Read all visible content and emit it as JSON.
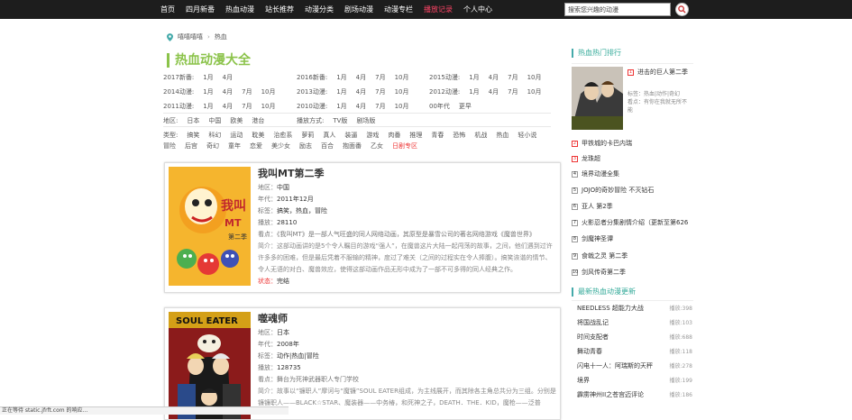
{
  "nav": {
    "items": [
      "首页",
      "四月新番",
      "热血动漫",
      "站长推荐",
      "动漫分类",
      "剧场动漫",
      "动漫专栏",
      "播放记录",
      "个人中心"
    ],
    "active_index": 7
  },
  "search": {
    "value": "搜索您兴趣的动漫"
  },
  "breadcrumb": {
    "home": "嘻嘻嘻嘻",
    "sep": "›",
    "current": "热血"
  },
  "page_title": "热血动漫大全",
  "filters": {
    "years": [
      {
        "label": "2017新番:",
        "items": [
          "1月",
          "4月"
        ]
      },
      {
        "label": "2016新番:",
        "items": [
          "1月",
          "4月",
          "7月",
          "10月"
        ]
      },
      {
        "label": "2015动漫:",
        "items": [
          "1月",
          "4月",
          "7月",
          "10月"
        ]
      },
      {
        "label": "2014动漫:",
        "items": [
          "1月",
          "4月",
          "7月",
          "10月"
        ]
      },
      {
        "label": "2013动漫:",
        "items": [
          "1月",
          "4月",
          "7月",
          "10月"
        ]
      },
      {
        "label": "2012动漫:",
        "items": [
          "1月",
          "4月",
          "7月",
          "10月"
        ]
      },
      {
        "label": "2011动漫:",
        "items": [
          "1月",
          "4月",
          "7月",
          "10月"
        ]
      },
      {
        "label": "2010动漫:",
        "items": [
          "1月",
          "4月",
          "7月",
          "10月"
        ]
      },
      {
        "label": "00年代",
        "items": [
          "更早"
        ]
      }
    ],
    "region": {
      "label": "地区:",
      "items": [
        "日本",
        "中国",
        "欧美",
        "港台"
      ]
    },
    "format": {
      "label": "播放方式:",
      "items": [
        "TV版",
        "剧场版"
      ]
    },
    "type": {
      "label": "类型:",
      "row1": [
        "搞笑",
        "科幻",
        "运动",
        "耽美",
        "治愈系",
        "萝莉",
        "真人",
        "装逼",
        "游戏",
        "肉番",
        "推理",
        "青春",
        "恐怖",
        "机战",
        "热血",
        "轻小说"
      ],
      "row2": [
        "冒险",
        "后宫",
        "奇幻",
        "童年",
        "恋爱",
        "美少女",
        "励志",
        "百合",
        "抱面番",
        "乙女",
        "日剧专区"
      ]
    }
  },
  "cards": [
    {
      "title": "我叫MT第二季",
      "region": "中国",
      "year": "2011年12月",
      "tags": "搞笑，热血，冒险",
      "plays": "28110",
      "intro": "《我叫MT》是一部人气旺盛的同人网络动画，其原型是暴雪公司的著名网络游戏《魔兽世界》",
      "desc": "这部动画讲的是5个令人瞩目的游戏“强人”，在魔兽这片大陆一起闯荡的故事，之间，他们遇到过许许多多的困难，但是最后凭着不服输的精神，度过了难关（之间的过程实在令人捧腹）。搞笑诙谐的情节、令人无语的对白、魔兽效应，使得这部动画作品无形中成为了一部不可多得的同人经典之作。",
      "status": "完结",
      "labels": {
        "region": "地区：",
        "year": "年代：",
        "tags": "标签：",
        "plays": "播放：",
        "intro": "看点：",
        "desc": "简介：",
        "status": "状态："
      }
    },
    {
      "title": "噬魂师",
      "region": "日本",
      "year": "2008年",
      "tags": "动作|热血|冒险",
      "plays": "128735",
      "intro": "舞台为死神武器职人专门学校",
      "desc": "故事以“镰职人”摩诃与“魔镰”SOUL EATER组成，为主线展开，而其除各主角总共分为三组。分别是镰镰职人——BLACK☆STAR、魔装器——中务椿，和死神之子，DEATH．THE．KID，魔枪——泛普",
      "status": "",
      "labels": {
        "region": "地区：",
        "year": "年代：",
        "tags": "标签：",
        "plays": "播放：",
        "intro": "看点：",
        "desc": "简介：",
        "status": "状态："
      }
    }
  ],
  "sidebar": {
    "rank_title": "热血热门排行",
    "top": {
      "num": "1",
      "name": "进击的巨人第二季",
      "tags_label": "标签：",
      "tags": "热血|动作|奇幻",
      "intro_label": "看点：",
      "intro": "有你在我就无所不能"
    },
    "rank": [
      {
        "num": "2",
        "name": "甲铁城的卡巴内瑞",
        "hot": true
      },
      {
        "num": "3",
        "name": "龙珠超",
        "hot": true
      },
      {
        "num": "4",
        "name": "境界动漫全集",
        "hot": false
      },
      {
        "num": "5",
        "name": "JOJO的奇妙冒险 不灭钻石",
        "hot": false
      },
      {
        "num": "6",
        "name": "亚人 第2季",
        "hot": false
      },
      {
        "num": "7",
        "name": "火影忍者分集剧情介绍（更新至第626",
        "hot": false
      },
      {
        "num": "8",
        "name": "剑魔神圣谭",
        "hot": false
      },
      {
        "num": "9",
        "name": "食戟之灵 第二季",
        "hot": false
      },
      {
        "num": "10",
        "name": "剑风传奇第二季",
        "hot": false
      }
    ],
    "update_title": "最新热血动漫更新",
    "updates": [
      {
        "name": "NEEDLESS 超能力大战",
        "plays": "播放:398"
      },
      {
        "name": "将国战乱记",
        "plays": "播放:103"
      },
      {
        "name": "时间支配者",
        "plays": "播放:688"
      },
      {
        "name": "舞动青春",
        "plays": "播放:118"
      },
      {
        "name": "闪电十一人：阿瑞斯的天秤",
        "plays": "播放:278"
      },
      {
        "name": "境界",
        "plays": "播放:199"
      },
      {
        "name": "霹雳神州II之苍宫迈评论",
        "plays": "播放:186"
      }
    ]
  },
  "statusbar": "正在等待 static.jfrft.com 的响应...",
  "colors": {
    "accent": "#8bc34a",
    "hot": "#e33333",
    "topbar": "#1d1d1d",
    "sidebar_accent": "#33aa99"
  }
}
